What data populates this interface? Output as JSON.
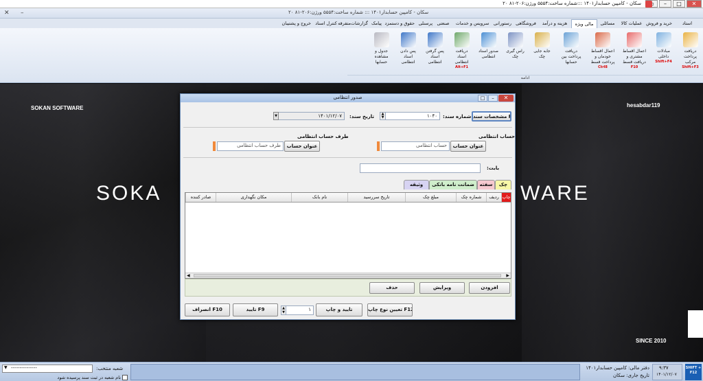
{
  "window": {
    "title": "سکان - کامپین حسابدار۱۴۰۱ :::شماره ساخت:۵۵۵۴  ورژن:۲۰۶-۸۱ ۲۰"
  },
  "ribbon": {
    "inner_title": "سکان - کامپین حسابدار۱۴۰۱ ::: شماره ساخت:۵۵۵۴   ورژن:۲۰۶-۸۱ ۲۰",
    "tabs": [
      "استاد",
      "خرید و فروش",
      "عملیات کالا",
      "مسائلی",
      "مالی ویژه",
      "هزینه و درآمد",
      "فروشگاهی",
      "رستورانی",
      "سرویس و خدمات",
      "صنعتی",
      "پرسنلی",
      "حقوق و دستمزد",
      "پیامک",
      "گزارشات",
      "متفرقه",
      "کنترل اسناد",
      "خروج و پشتیبان"
    ],
    "active_tab": "مالی ویژه",
    "buttons": [
      {
        "label": "دریافت پرداخت مرکب",
        "key": "Shift+F3"
      },
      {
        "label": "مبادلات داخلی",
        "key": "Shift+F4"
      },
      {
        "label": "اعمال اقساط مشتری و دریافت قسط",
        "key": "F10"
      },
      {
        "label": "اعمال اقساط خودمان و پرداخت قسط",
        "key": "Ctrl8"
      },
      {
        "label": "دریافت پرداخت بین حسابها",
        "key": ""
      },
      {
        "label": "جابه جایی چک",
        "key": ""
      },
      {
        "label": "راس گیری چک",
        "key": ""
      },
      {
        "label": "صدور اسناد انتظامی",
        "key": ""
      },
      {
        "label": "دریافت اسناد انتظامی",
        "key": "Alt+F1"
      },
      {
        "label": "پس گرفتن اسناد انتظامی",
        "key": ""
      },
      {
        "label": "پس دادن اسناد انتظامی",
        "key": ""
      },
      {
        "label": "جدول و مشاهده حسابها",
        "key": ""
      }
    ],
    "group_label": "ادامه"
  },
  "splash": {
    "brand_small": "SOKAN SOFTWARE",
    "big_left": "SOKA",
    "big_right": "WARE",
    "user": "hesabdar119",
    "since": "SINCE 2010"
  },
  "dialog": {
    "title": "صدور انتظامی",
    "doc_spec_button": "مشخصات سند F1",
    "doc_number_label": "شماره سند:",
    "doc_number_value": "۱۰۴۰",
    "doc_date_label": "تاریخ سند:",
    "doc_date_value": "۱۴۰۱/۱۲/۰۷",
    "account_label": "حساب انتظامی",
    "account_button": "عنوان حساب",
    "account_value": "حساب انتظامی",
    "counter_label": "طرف حساب انتظامی",
    "counter_button": "عنوان حساب",
    "counter_value": "طرف حساب انتظامی",
    "babat_label": "بابت:",
    "babat_value": "",
    "tabs": [
      "چک",
      "سفته",
      "ضمانت نامه بانکی",
      "وثیقه"
    ],
    "active_tab": "چک",
    "columns": [
      "چاپ",
      "ردیف",
      "شماره چک",
      "مبلغ چک",
      "تاریخ سررسید",
      "نام بانک",
      "مکان نگهداری",
      "صادر کننده"
    ],
    "add_button": "افزودن",
    "edit_button": "ویرایش",
    "delete_button": "حذف",
    "print_type_button": "تعیین نوع چاپ F12",
    "confirm_print_button": "تایید و چاپ",
    "copies_value": "۱",
    "confirm_button": "تایید F9",
    "cancel_button": "انصراف F10"
  },
  "status": {
    "branch_label": "شعبه منتخب:",
    "branch_value": "---------------",
    "branch_check": "نام شعبه در ثبت سند پرسیده شود",
    "fiscal": "دفتر مالی: کامپین حسابدار۱۴۰۱",
    "current_date": "تاریخ جاری: سکان",
    "time": "۹:۳۷",
    "date": "۱۴۰۱/۱۲/۰۷",
    "shift_key": "SHIFT + F12"
  }
}
